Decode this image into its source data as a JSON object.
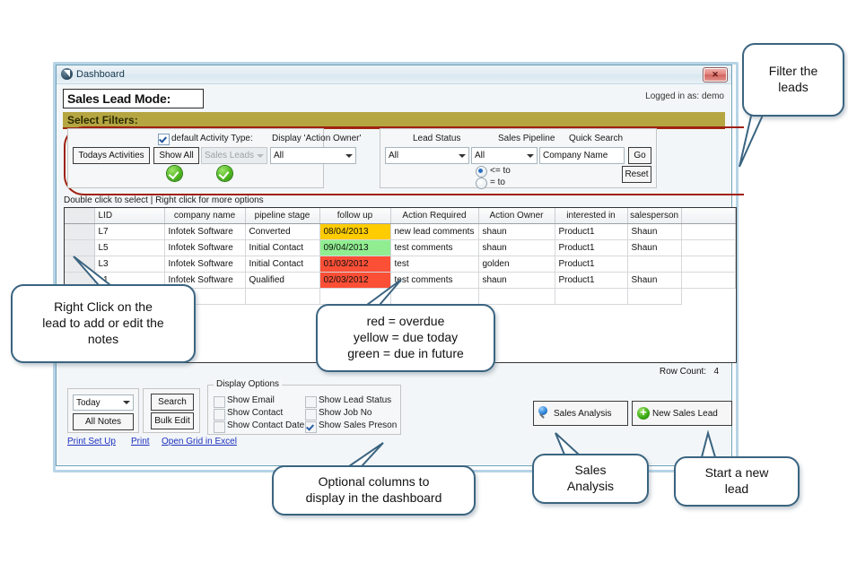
{
  "window": {
    "title": "Dashboard",
    "close_label": "✕",
    "mode_label": "Sales Lead Mode:",
    "logged_in": "Logged in as: demo",
    "filters_header": "Select Filters:"
  },
  "filters": {
    "left_panel": {
      "default_checkbox_label": "default",
      "default_checked": true,
      "todays_activities_button": "Todays Activities",
      "show_all_button": "Show All",
      "activity_type_label": "Activity Type:",
      "activity_type_value": "Sales Leads",
      "activity_type_disabled": true,
      "display_action_owner_label": "Display 'Action Owner'",
      "display_action_owner_value": "All"
    },
    "right_panel": {
      "lead_status_label": "Lead Status",
      "lead_status_value": "All",
      "sales_pipeline_label": "Sales Pipeline",
      "sales_pipeline_value": "All",
      "quick_search_label": "Quick Search",
      "quick_search_value": "Company Name",
      "go_button": "Go",
      "reset_button": "Reset",
      "radio_lte_label": "<= to",
      "radio_eq_label": "= to",
      "radio_selected": "lte"
    }
  },
  "grid": {
    "hint": "Double click to select  |  Right click for more options",
    "columns": [
      "LID",
      "company name",
      "pipeline stage",
      "follow up",
      "Action Required",
      "Action Owner",
      "interested in",
      "salesperson"
    ],
    "rows": [
      {
        "lid": "L7",
        "company_name": "Infotek Software",
        "pipeline_stage": "Converted",
        "follow_up": "08/04/2013",
        "follow_up_color": "#FFCC00",
        "action_required": "new lead comments",
        "action_owner": "shaun",
        "interested_in": "Product1",
        "salesperson": "Shaun"
      },
      {
        "lid": "L5",
        "company_name": "Infotek Software",
        "pipeline_stage": "Initial Contact",
        "follow_up": "09/04/2013",
        "follow_up_color": "#90EE90",
        "action_required": "test comments",
        "action_owner": "shaun",
        "interested_in": "Product1",
        "salesperson": "Shaun"
      },
      {
        "lid": "L3",
        "company_name": "Infotek Software",
        "pipeline_stage": "Initial Contact",
        "follow_up": "01/03/2012",
        "follow_up_color": "#FB4F36",
        "action_required": "test",
        "action_owner": "golden",
        "interested_in": "Product1",
        "salesperson": ""
      },
      {
        "lid": "L1",
        "company_name": "Infotek Software",
        "pipeline_stage": "Qualified",
        "follow_up": "02/03/2012",
        "follow_up_color": "#FB4F36",
        "action_required": "test comments",
        "action_owner": "shaun",
        "interested_in": "Product1",
        "salesperson": "Shaun"
      }
    ],
    "row_count_label": "Row Count:",
    "row_count_value": "4"
  },
  "bottom": {
    "period_select_value": "Today",
    "all_notes_button": "All Notes",
    "search_button": "Search",
    "bulk_edit_button": "Bulk Edit",
    "display_options_legend": "Display Options",
    "options": [
      {
        "label": "Show Email",
        "checked": false
      },
      {
        "label": "Show Contact",
        "checked": false
      },
      {
        "label": "Show Contact Date",
        "checked": false
      },
      {
        "label": "Show Lead Status",
        "checked": false
      },
      {
        "label": "Show Job No",
        "checked": false
      },
      {
        "label": "Show Sales Preson",
        "checked": true
      }
    ],
    "links": [
      "Print Set Up",
      "Print",
      "Open Grid in Excel"
    ],
    "sales_analysis_button": "Sales Analysis",
    "new_sales_lead_button": "New Sales Lead"
  },
  "callouts": {
    "filter_the_leads": "Filter the\nleads",
    "right_click_notes": "Right Click on the\nlead to add or edit the\nnotes",
    "color_legend": "red = overdue\nyellow = due today\ngreen = due in future",
    "optional_columns": "Optional columns to\ndisplay in the dashboard",
    "sales_analysis": "Sales\nAnalysis",
    "start_new_lead": "Start a new\nlead"
  },
  "colors": {
    "filters_bar": "#b5a642",
    "highlight_ring": "#a02010",
    "callout_border": "#3a6480",
    "link": "#1a2fbe"
  }
}
